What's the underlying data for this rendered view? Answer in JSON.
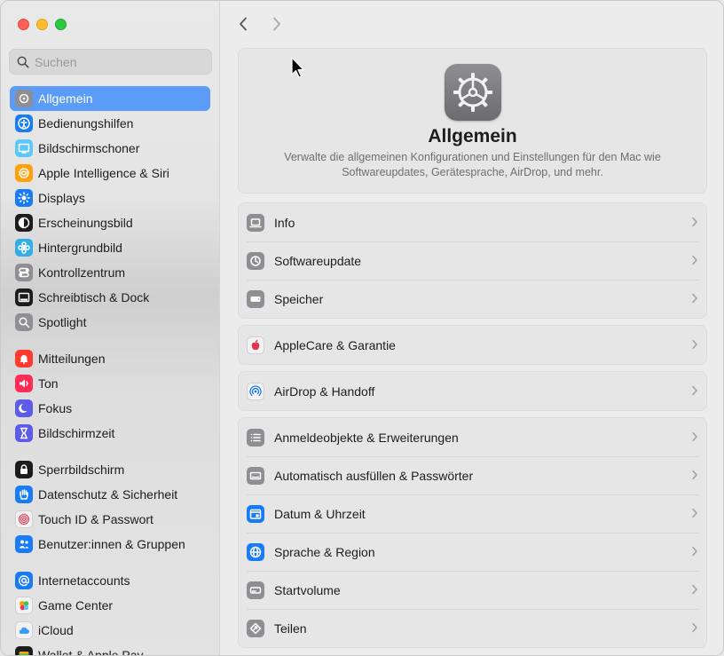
{
  "window": {
    "traffic_lights": {
      "close": "#fe5f57",
      "minimize": "#febc2e",
      "zoom": "#28c840"
    }
  },
  "search": {
    "placeholder": "Suchen",
    "icon": "magnifier-icon"
  },
  "sidebar": {
    "accent": "#5a9cf8",
    "items": [
      {
        "label": "Allgemein",
        "icon": "gear-icon",
        "color": "#8e8e93",
        "active": true
      },
      {
        "label": "Bedienungshilfen",
        "icon": "accessibility-icon",
        "color": "#1a7cf5"
      },
      {
        "label": "Bildschirmschoner",
        "icon": "screensaver-icon",
        "color": "#5ac8fa"
      },
      {
        "label": "Apple Intelligence & Siri",
        "icon": "siri-icon",
        "color": "#ff9f0a"
      },
      {
        "label": "Displays",
        "icon": "sun-icon",
        "color": "#1a7cf5"
      },
      {
        "label": "Erscheinungsbild",
        "icon": "appearance-icon",
        "color": "#1c1c1e"
      },
      {
        "label": "Hintergrundbild",
        "icon": "flower-icon",
        "color": "#32ade6"
      },
      {
        "label": "Kontrollzentrum",
        "icon": "toggles-icon",
        "color": "#8e8e93"
      },
      {
        "label": "Schreibtisch & Dock",
        "icon": "dock-icon",
        "color": "#1c1c1e"
      },
      {
        "label": "Spotlight",
        "icon": "spotlight-icon",
        "color": "#8e8e93"
      },
      {
        "label": "Mitteilungen",
        "icon": "bell-icon",
        "color": "#ff3b30"
      },
      {
        "label": "Ton",
        "icon": "speaker-icon",
        "color": "#ff2d55"
      },
      {
        "label": "Fokus",
        "icon": "moon-icon",
        "color": "#5e5ce6"
      },
      {
        "label": "Bildschirmzeit",
        "icon": "hourglass-icon",
        "color": "#5e5ce6"
      },
      {
        "label": "Sperrbildschirm",
        "icon": "lock-icon",
        "color": "#1c1c1e"
      },
      {
        "label": "Datenschutz & Sicherheit",
        "icon": "hand-icon",
        "color": "#1a7cf5"
      },
      {
        "label": "Touch ID & Passwort",
        "icon": "fingerprint-icon",
        "color": "#f2f2f2"
      },
      {
        "label": "Benutzer:innen & Gruppen",
        "icon": "users-icon",
        "color": "#1a7cf5"
      },
      {
        "label": "Internetaccounts",
        "icon": "at-icon",
        "color": "#1a7cf5"
      },
      {
        "label": "Game Center",
        "icon": "game-center-icon",
        "color": "#f2f2f2"
      },
      {
        "label": "iCloud",
        "icon": "cloud-icon",
        "color": "#f2f2f2"
      },
      {
        "label": "Wallet & Apple Pay",
        "icon": "wallet-icon",
        "color": "#1c1c1e"
      }
    ]
  },
  "toolbar": {
    "back": "chevron-left-icon",
    "forward": "chevron-right-icon"
  },
  "hero": {
    "title": "Allgemein",
    "description": "Verwalte die allgemeinen Konfigurationen und Einstellungen für den Mac wie Softwareupdates, Gerätesprache, AirDrop, und mehr."
  },
  "groups": [
    {
      "rows": [
        {
          "label": "Info",
          "icon": "laptop-icon",
          "color": "#8e8e93"
        },
        {
          "label": "Softwareupdate",
          "icon": "update-gear-icon",
          "color": "#8e8e93"
        },
        {
          "label": "Speicher",
          "icon": "drive-icon",
          "color": "#8e8e93"
        }
      ]
    },
    {
      "rows": [
        {
          "label": "AppleCare & Garantie",
          "icon": "apple-icon",
          "color": "#f2f2f2"
        }
      ]
    },
    {
      "rows": [
        {
          "label": "AirDrop & Handoff",
          "icon": "airdrop-icon",
          "color": "#f2f2f2"
        }
      ]
    },
    {
      "rows": [
        {
          "label": "Anmeldeobjekte & Erweiterungen",
          "icon": "list-icon",
          "color": "#8e8e93"
        },
        {
          "label": "Automatisch ausfüllen & Passwörter",
          "icon": "keyboard-icon",
          "color": "#8e8e93"
        },
        {
          "label": "Datum & Uhrzeit",
          "icon": "calendar-clock-icon",
          "color": "#1a7cf5"
        },
        {
          "label": "Sprache & Region",
          "icon": "globe-icon",
          "color": "#1a7cf5"
        },
        {
          "label": "Startvolume",
          "icon": "disk-icon",
          "color": "#8e8e93"
        },
        {
          "label": "Teilen",
          "icon": "share-icon",
          "color": "#8e8e93"
        }
      ]
    }
  ]
}
